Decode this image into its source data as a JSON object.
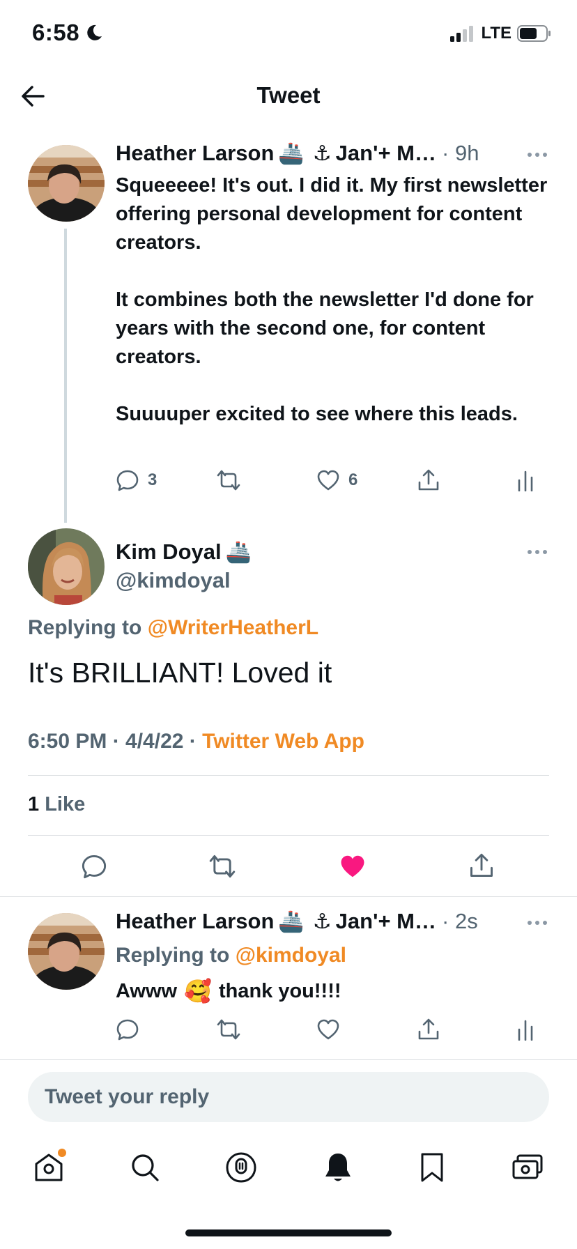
{
  "status_bar": {
    "time": "6:58",
    "network": "LTE"
  },
  "header": {
    "title": "Tweet"
  },
  "parent_tweet": {
    "author": "Heather Larson",
    "handle_tail": "Jan'+ M…",
    "time": "· 9h",
    "paragraphs": [
      "Squeeeee! It's out. I did it. My first newsletter offering personal development for content creators.",
      "It combines both the newsletter I'd done for years with the second one, for content creators.",
      "Suuuuper excited to see where this leads."
    ],
    "reply_count": "3",
    "like_count": "6"
  },
  "main_tweet": {
    "author": "Kim Doyal",
    "handle": "@kimdoyal",
    "replying_prefix": "Replying to",
    "replying_handle": "@WriterHeatherL",
    "text": "It's BRILLIANT! Loved it",
    "timestamp": "6:50 PM · 4/4/22 ·",
    "source": "Twitter Web App",
    "like_count": "1",
    "like_label": "Like"
  },
  "reply_tweet": {
    "author": "Heather Larson",
    "handle_tail": "Jan'+ M…",
    "time": "· 2s",
    "replying_prefix": "Replying to",
    "replying_handle": "@kimdoyal",
    "text_before": "Awww",
    "text_after": "thank you!!!!"
  },
  "reply_input": {
    "placeholder": "Tweet your reply"
  },
  "colors": {
    "accent": "#f08a24",
    "like_pink": "#f91880",
    "muted": "#536471"
  },
  "icons": [
    "back-arrow-icon",
    "moon-icon",
    "signal-icon",
    "battery-icon",
    "ship-emoji",
    "anchor-emoji",
    "more-icon",
    "reply-icon",
    "retweet-icon",
    "like-icon",
    "share-icon",
    "analytics-icon",
    "home-icon",
    "search-icon",
    "spaces-icon",
    "notifications-icon",
    "bookmarks-icon",
    "money-icon"
  ]
}
